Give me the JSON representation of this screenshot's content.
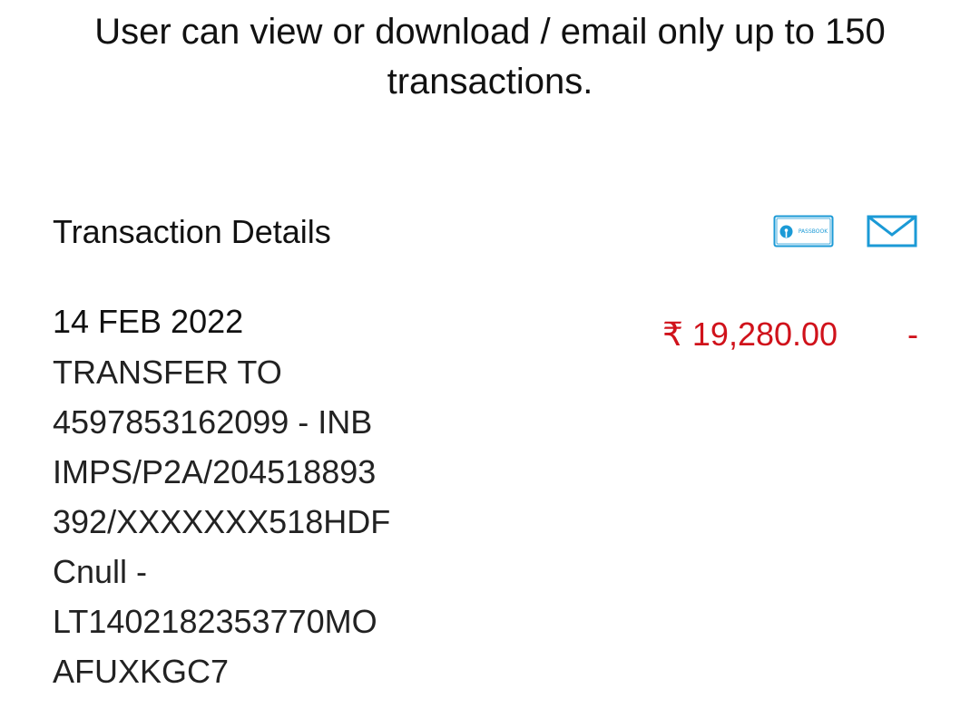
{
  "notice": {
    "text": "User can view or download / email only up to 150 transactions."
  },
  "section": {
    "title": "Transaction Details",
    "passbook_label": "PASSBOOK"
  },
  "transactions": [
    {
      "date": "14 FEB 2022",
      "description_lines": [
        "TRANSFER TO",
        "4597853162099 - INB",
        "IMPS/P2A/204518893",
        "392/XXXXXXX518HDF",
        "Cnull -",
        "LT1402182353770MO",
        "AFUXKGC7"
      ],
      "debit": "₹ 19,280.00",
      "credit": "-"
    }
  ],
  "colors": {
    "debit": "#d0121b",
    "icon_accent": "#1b9ad6"
  },
  "icons": {
    "passbook": "passbook-icon",
    "email": "email-icon"
  }
}
